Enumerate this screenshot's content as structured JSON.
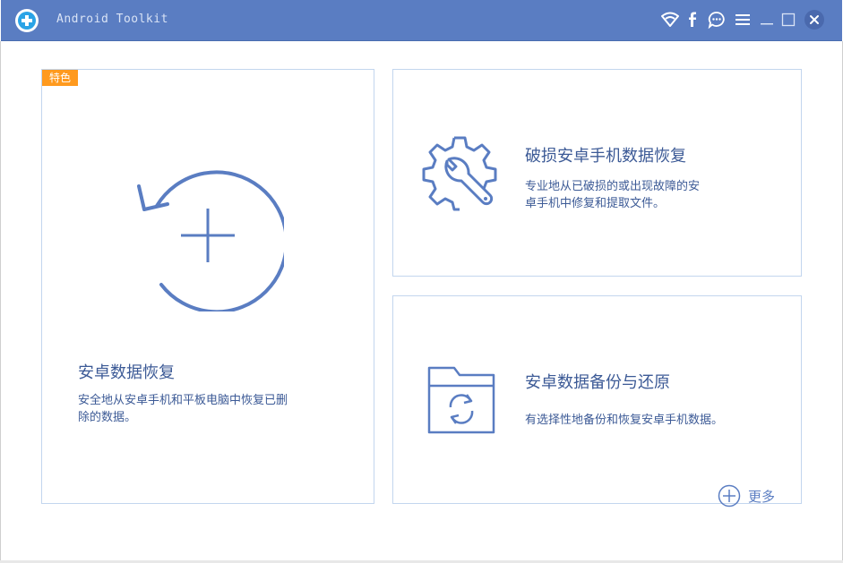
{
  "app": {
    "title": "Android Toolkit"
  },
  "titlebar": {
    "icons": [
      "app-logo-icon",
      "wifi-icon",
      "facebook-icon",
      "chat-icon",
      "menu-icon",
      "minimize-icon",
      "maximize-icon",
      "close-icon"
    ]
  },
  "cards": {
    "recover": {
      "badge": "特色",
      "title": "安卓数据恢复",
      "desc_line1": "安全地从安卓手机和平板电脑中恢复已删",
      "desc_line2": "除的数据。",
      "icon": "recover-plus-icon"
    },
    "broken": {
      "title": "破损安卓手机数据恢复",
      "desc_line1": "专业地从已破损的或出现故障的安",
      "desc_line2": "卓手机中修复和提取文件。",
      "icon": "gear-wrench-icon"
    },
    "backup": {
      "title": "安卓数据备份与还原",
      "desc": "有选择性地备份和恢复安卓手机数据。",
      "icon": "folder-sync-icon"
    }
  },
  "more": {
    "label": "更多",
    "icon": "plus-circle-icon"
  },
  "colors": {
    "titlebar": "#5a7dc2",
    "accent": "#5a7dc2",
    "text": "#3c5a96",
    "badge": "#ff9a1e",
    "card_border": "#c3d6ee"
  }
}
